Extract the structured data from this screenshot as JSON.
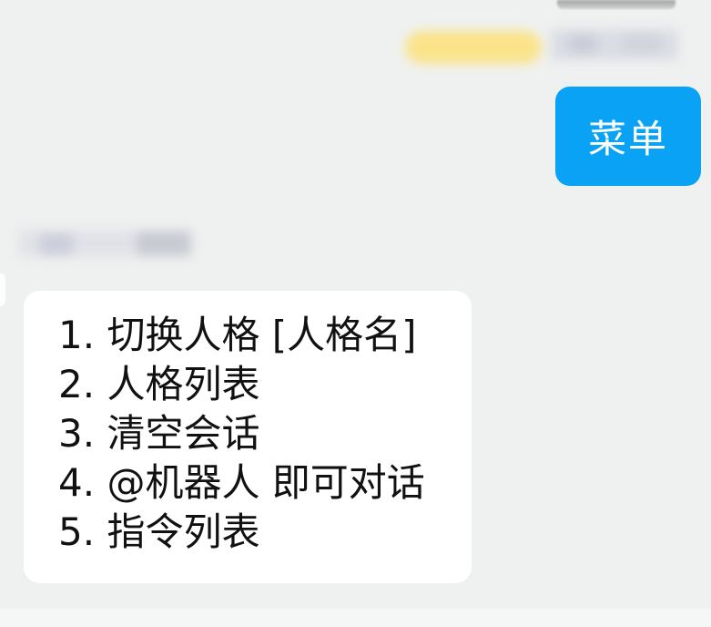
{
  "chat": {
    "user_message": "菜单",
    "bot_menu": [
      {
        "number": "1.",
        "text": "切换人格 [人格名]"
      },
      {
        "number": "2.",
        "text": "人格列表"
      },
      {
        "number": "3.",
        "text": "清空会话"
      },
      {
        "number": "4.",
        "text": "@机器人 即可对话"
      },
      {
        "number": "5.",
        "text": "指令列表"
      }
    ]
  },
  "colors": {
    "background": "#eff1f0",
    "user_bubble": "#0aa2f5",
    "bot_bubble": "#ffffff",
    "text": "#111111"
  }
}
